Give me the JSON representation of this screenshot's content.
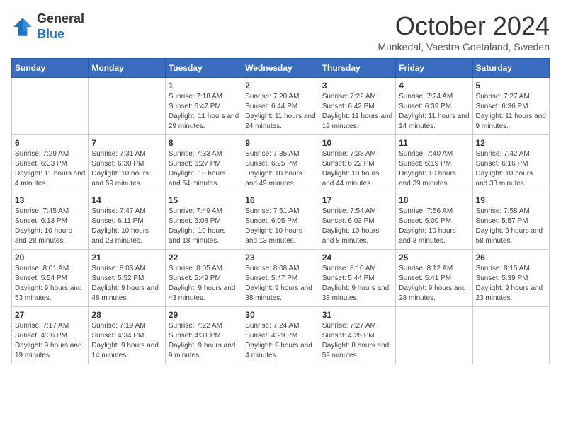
{
  "header": {
    "logo_line1": "General",
    "logo_line2": "Blue",
    "month_title": "October 2024",
    "location": "Munkedal, Vaestra Goetaland, Sweden"
  },
  "weekdays": [
    "Sunday",
    "Monday",
    "Tuesday",
    "Wednesday",
    "Thursday",
    "Friday",
    "Saturday"
  ],
  "weeks": [
    [
      {
        "day": "",
        "sunrise": "",
        "sunset": "",
        "daylight": ""
      },
      {
        "day": "",
        "sunrise": "",
        "sunset": "",
        "daylight": ""
      },
      {
        "day": "1",
        "sunrise": "Sunrise: 7:18 AM",
        "sunset": "Sunset: 6:47 PM",
        "daylight": "Daylight: 11 hours and 29 minutes."
      },
      {
        "day": "2",
        "sunrise": "Sunrise: 7:20 AM",
        "sunset": "Sunset: 6:44 PM",
        "daylight": "Daylight: 11 hours and 24 minutes."
      },
      {
        "day": "3",
        "sunrise": "Sunrise: 7:22 AM",
        "sunset": "Sunset: 6:42 PM",
        "daylight": "Daylight: 11 hours and 19 minutes."
      },
      {
        "day": "4",
        "sunrise": "Sunrise: 7:24 AM",
        "sunset": "Sunset: 6:39 PM",
        "daylight": "Daylight: 11 hours and 14 minutes."
      },
      {
        "day": "5",
        "sunrise": "Sunrise: 7:27 AM",
        "sunset": "Sunset: 6:36 PM",
        "daylight": "Daylight: 11 hours and 9 minutes."
      }
    ],
    [
      {
        "day": "6",
        "sunrise": "Sunrise: 7:29 AM",
        "sunset": "Sunset: 6:33 PM",
        "daylight": "Daylight: 11 hours and 4 minutes."
      },
      {
        "day": "7",
        "sunrise": "Sunrise: 7:31 AM",
        "sunset": "Sunset: 6:30 PM",
        "daylight": "Daylight: 10 hours and 59 minutes."
      },
      {
        "day": "8",
        "sunrise": "Sunrise: 7:33 AM",
        "sunset": "Sunset: 6:27 PM",
        "daylight": "Daylight: 10 hours and 54 minutes."
      },
      {
        "day": "9",
        "sunrise": "Sunrise: 7:35 AM",
        "sunset": "Sunset: 6:25 PM",
        "daylight": "Daylight: 10 hours and 49 minutes."
      },
      {
        "day": "10",
        "sunrise": "Sunrise: 7:38 AM",
        "sunset": "Sunset: 6:22 PM",
        "daylight": "Daylight: 10 hours and 44 minutes."
      },
      {
        "day": "11",
        "sunrise": "Sunrise: 7:40 AM",
        "sunset": "Sunset: 6:19 PM",
        "daylight": "Daylight: 10 hours and 39 minutes."
      },
      {
        "day": "12",
        "sunrise": "Sunrise: 7:42 AM",
        "sunset": "Sunset: 6:16 PM",
        "daylight": "Daylight: 10 hours and 33 minutes."
      }
    ],
    [
      {
        "day": "13",
        "sunrise": "Sunrise: 7:45 AM",
        "sunset": "Sunset: 6:13 PM",
        "daylight": "Daylight: 10 hours and 28 minutes."
      },
      {
        "day": "14",
        "sunrise": "Sunrise: 7:47 AM",
        "sunset": "Sunset: 6:11 PM",
        "daylight": "Daylight: 10 hours and 23 minutes."
      },
      {
        "day": "15",
        "sunrise": "Sunrise: 7:49 AM",
        "sunset": "Sunset: 6:08 PM",
        "daylight": "Daylight: 10 hours and 18 minutes."
      },
      {
        "day": "16",
        "sunrise": "Sunrise: 7:51 AM",
        "sunset": "Sunset: 6:05 PM",
        "daylight": "Daylight: 10 hours and 13 minutes."
      },
      {
        "day": "17",
        "sunrise": "Sunrise: 7:54 AM",
        "sunset": "Sunset: 6:03 PM",
        "daylight": "Daylight: 10 hours and 8 minutes."
      },
      {
        "day": "18",
        "sunrise": "Sunrise: 7:56 AM",
        "sunset": "Sunset: 6:00 PM",
        "daylight": "Daylight: 10 hours and 3 minutes."
      },
      {
        "day": "19",
        "sunrise": "Sunrise: 7:58 AM",
        "sunset": "Sunset: 5:57 PM",
        "daylight": "Daylight: 9 hours and 58 minutes."
      }
    ],
    [
      {
        "day": "20",
        "sunrise": "Sunrise: 8:01 AM",
        "sunset": "Sunset: 5:54 PM",
        "daylight": "Daylight: 9 hours and 53 minutes."
      },
      {
        "day": "21",
        "sunrise": "Sunrise: 8:03 AM",
        "sunset": "Sunset: 5:52 PM",
        "daylight": "Daylight: 9 hours and 48 minutes."
      },
      {
        "day": "22",
        "sunrise": "Sunrise: 8:05 AM",
        "sunset": "Sunset: 5:49 PM",
        "daylight": "Daylight: 9 hours and 43 minutes."
      },
      {
        "day": "23",
        "sunrise": "Sunrise: 8:08 AM",
        "sunset": "Sunset: 5:47 PM",
        "daylight": "Daylight: 9 hours and 38 minutes."
      },
      {
        "day": "24",
        "sunrise": "Sunrise: 8:10 AM",
        "sunset": "Sunset: 5:44 PM",
        "daylight": "Daylight: 9 hours and 33 minutes."
      },
      {
        "day": "25",
        "sunrise": "Sunrise: 8:12 AM",
        "sunset": "Sunset: 5:41 PM",
        "daylight": "Daylight: 9 hours and 28 minutes."
      },
      {
        "day": "26",
        "sunrise": "Sunrise: 8:15 AM",
        "sunset": "Sunset: 5:39 PM",
        "daylight": "Daylight: 9 hours and 23 minutes."
      }
    ],
    [
      {
        "day": "27",
        "sunrise": "Sunrise: 7:17 AM",
        "sunset": "Sunset: 4:36 PM",
        "daylight": "Daylight: 9 hours and 19 minutes."
      },
      {
        "day": "28",
        "sunrise": "Sunrise: 7:19 AM",
        "sunset": "Sunset: 4:34 PM",
        "daylight": "Daylight: 9 hours and 14 minutes."
      },
      {
        "day": "29",
        "sunrise": "Sunrise: 7:22 AM",
        "sunset": "Sunset: 4:31 PM",
        "daylight": "Daylight: 9 hours and 9 minutes."
      },
      {
        "day": "30",
        "sunrise": "Sunrise: 7:24 AM",
        "sunset": "Sunset: 4:29 PM",
        "daylight": "Daylight: 9 hours and 4 minutes."
      },
      {
        "day": "31",
        "sunrise": "Sunrise: 7:27 AM",
        "sunset": "Sunset: 4:26 PM",
        "daylight": "Daylight: 8 hours and 59 minutes."
      },
      {
        "day": "",
        "sunrise": "",
        "sunset": "",
        "daylight": ""
      },
      {
        "day": "",
        "sunrise": "",
        "sunset": "",
        "daylight": ""
      }
    ]
  ]
}
